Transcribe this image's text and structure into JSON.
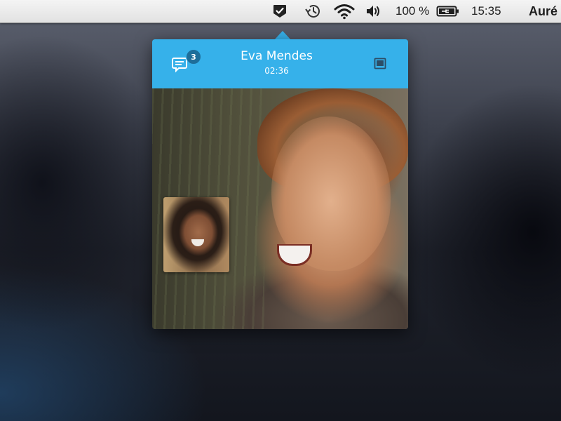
{
  "menubar": {
    "battery_percent": "100 %",
    "clock": "15:35",
    "user": "Auré",
    "icons": [
      "skype-check-icon",
      "time-machine-icon",
      "wifi-icon",
      "volume-icon",
      "battery-charging-icon"
    ]
  },
  "call": {
    "chat_badge_count": "3",
    "caller_name": "Eva Mendes",
    "duration": "02:36",
    "colors": {
      "header": "#36b1ea",
      "badge": "#1e6e9a",
      "hangup": "#e24430",
      "controls_bar": "#343e48"
    },
    "controls": [
      "video-camera-icon",
      "microphone-icon",
      "add-participant-icon",
      "hang-up-icon"
    ]
  }
}
